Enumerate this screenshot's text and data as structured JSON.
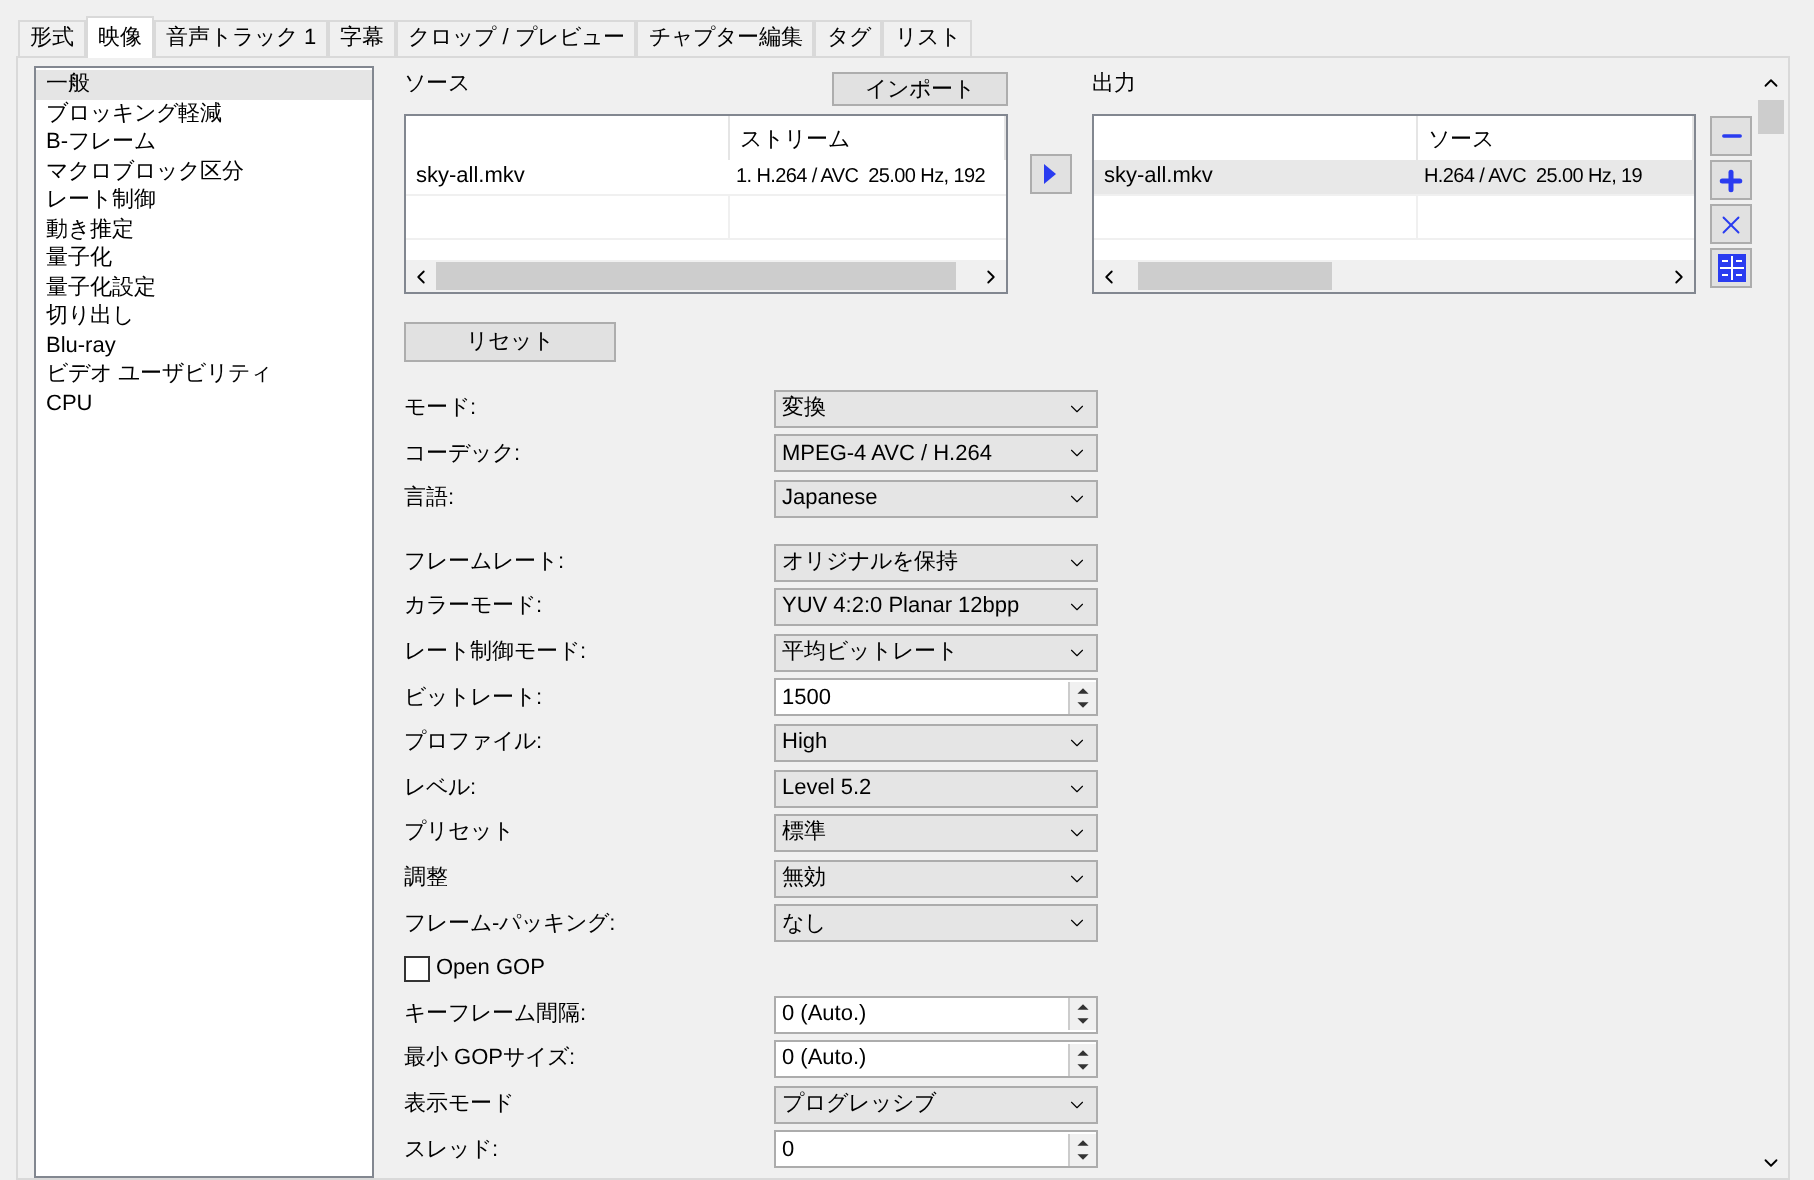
{
  "tabs": [
    {
      "label": "形式",
      "selected": false
    },
    {
      "label": "映像",
      "selected": true
    },
    {
      "label": "音声トラック 1",
      "selected": false
    },
    {
      "label": "字幕",
      "selected": false
    },
    {
      "label": "クロップ / プレビュー",
      "selected": false
    },
    {
      "label": "チャプター編集",
      "selected": false
    },
    {
      "label": "タグ",
      "selected": false
    },
    {
      "label": "リスト",
      "selected": false
    }
  ],
  "sidebar": {
    "items": [
      {
        "label": "一般",
        "selected": true
      },
      {
        "label": "ブロッキング軽減",
        "selected": false
      },
      {
        "label": "B-フレーム",
        "selected": false
      },
      {
        "label": "マクロブロック区分",
        "selected": false
      },
      {
        "label": "レート制御",
        "selected": false
      },
      {
        "label": "動き推定",
        "selected": false
      },
      {
        "label": "量子化",
        "selected": false
      },
      {
        "label": "量子化設定",
        "selected": false
      },
      {
        "label": "切り出し",
        "selected": false
      },
      {
        "label": "Blu-ray",
        "selected": false
      },
      {
        "label": "ビデオ ユーザビリティ",
        "selected": false
      },
      {
        "label": "CPU",
        "selected": false
      }
    ]
  },
  "source": {
    "title": "ソース",
    "import_button": "インポート",
    "columns": [
      "",
      "ストリーム"
    ],
    "rows": [
      {
        "cells": [
          "sky-all.mkv",
          "1. H.264 / AVC  25.00 Hz, 192"
        ],
        "selected": false
      }
    ]
  },
  "output": {
    "title": "出力",
    "columns": [
      "",
      "ソース"
    ],
    "rows": [
      {
        "cells": [
          "sky-all.mkv",
          "H.264 / AVC  25.00 Hz, 19"
        ],
        "selected": true
      }
    ]
  },
  "reset_button": "リセット",
  "form": {
    "sections": [
      {
        "fields": [
          {
            "kind": "select",
            "label": "モード:",
            "value": "変換"
          },
          {
            "kind": "select",
            "label": "コーデック:",
            "value": "MPEG-4 AVC / H.264"
          },
          {
            "kind": "select",
            "label": "言語:",
            "value": "Japanese"
          }
        ]
      },
      {
        "fields": [
          {
            "kind": "select",
            "label": "フレームレート:",
            "value": "オリジナルを保持"
          },
          {
            "kind": "select",
            "label": "カラーモード:",
            "value": "YUV 4:2:0 Planar 12bpp"
          },
          {
            "kind": "select",
            "label": "レート制御モード:",
            "value": "平均ビットレート"
          },
          {
            "kind": "spin",
            "label": "ビットレート:",
            "value": "1500"
          },
          {
            "kind": "select",
            "label": "プロファイル:",
            "value": "High"
          },
          {
            "kind": "select",
            "label": "レベル:",
            "value": "Level 5.2"
          },
          {
            "kind": "select",
            "label": "プリセット",
            "value": "標準"
          },
          {
            "kind": "select",
            "label": "調整",
            "value": "無効"
          },
          {
            "kind": "select",
            "label": "フレーム-パッキング:",
            "value": "なし"
          },
          {
            "kind": "checkbox",
            "label": "Open GOP",
            "checked": false
          },
          {
            "kind": "spin",
            "label": "キーフレーム間隔:",
            "value": "0 (Auto.)"
          },
          {
            "kind": "spin",
            "label": "最小 GOPサイズ:",
            "value": "0 (Auto.)"
          },
          {
            "kind": "select",
            "label": "表示モード",
            "value": "プログレッシブ"
          },
          {
            "kind": "spin",
            "label": "スレッド:",
            "value": "0"
          }
        ]
      }
    ]
  }
}
